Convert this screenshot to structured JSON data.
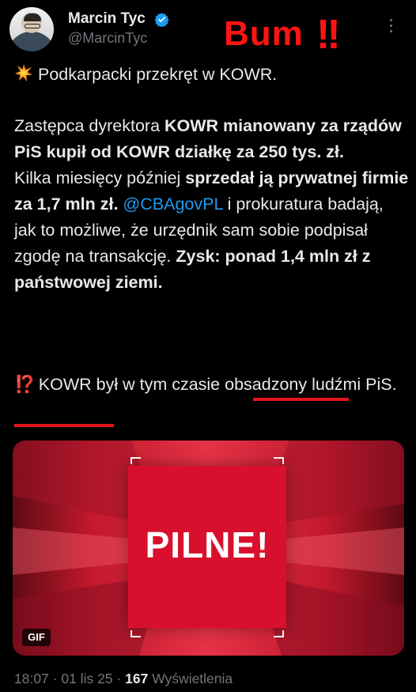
{
  "author": {
    "name": "Marcin Tyc",
    "handle": "@MarcinTyc",
    "verified": true
  },
  "overlay": {
    "text": "Bum",
    "bangs": "!!",
    "color": "#ff1414"
  },
  "icons": {
    "verified": "verified-badge-icon",
    "more": "more-options-icon",
    "burst": "collision-emoji",
    "exclamation_question": "exclamation-question-emoji"
  },
  "tweet": {
    "headline": "Podkarpacki przekręt w KOWR.",
    "p2": {
      "s1": "Zastępca dyrektora ",
      "b1": "KOWR mianowany za rządów PiS kupił od KOWR działkę za 250 tys. zł.",
      "s2": "Kilka miesięcy później ",
      "b2": "sprzedał ją prywatnej firmie za 1,7 mln zł.",
      "mention": "@CBAgovPL",
      "s3": " i prokuratura badają, jak to możliwe, że urzędnik sam sobie podpisał zgodę na transakcję. ",
      "b3": "Zysk: ponad 1,4 mln zł z państwowej ziemi."
    },
    "p3": {
      "emoji": "⁉️",
      "text": "KOWR był w tym czasie obsadzony ludźmi PiS."
    }
  },
  "media": {
    "title": "PILNE!",
    "badge": "GIF"
  },
  "meta": {
    "time": "18:07",
    "date": "01 lis 25",
    "views": "167",
    "views_label": "Wyświetlenia"
  }
}
